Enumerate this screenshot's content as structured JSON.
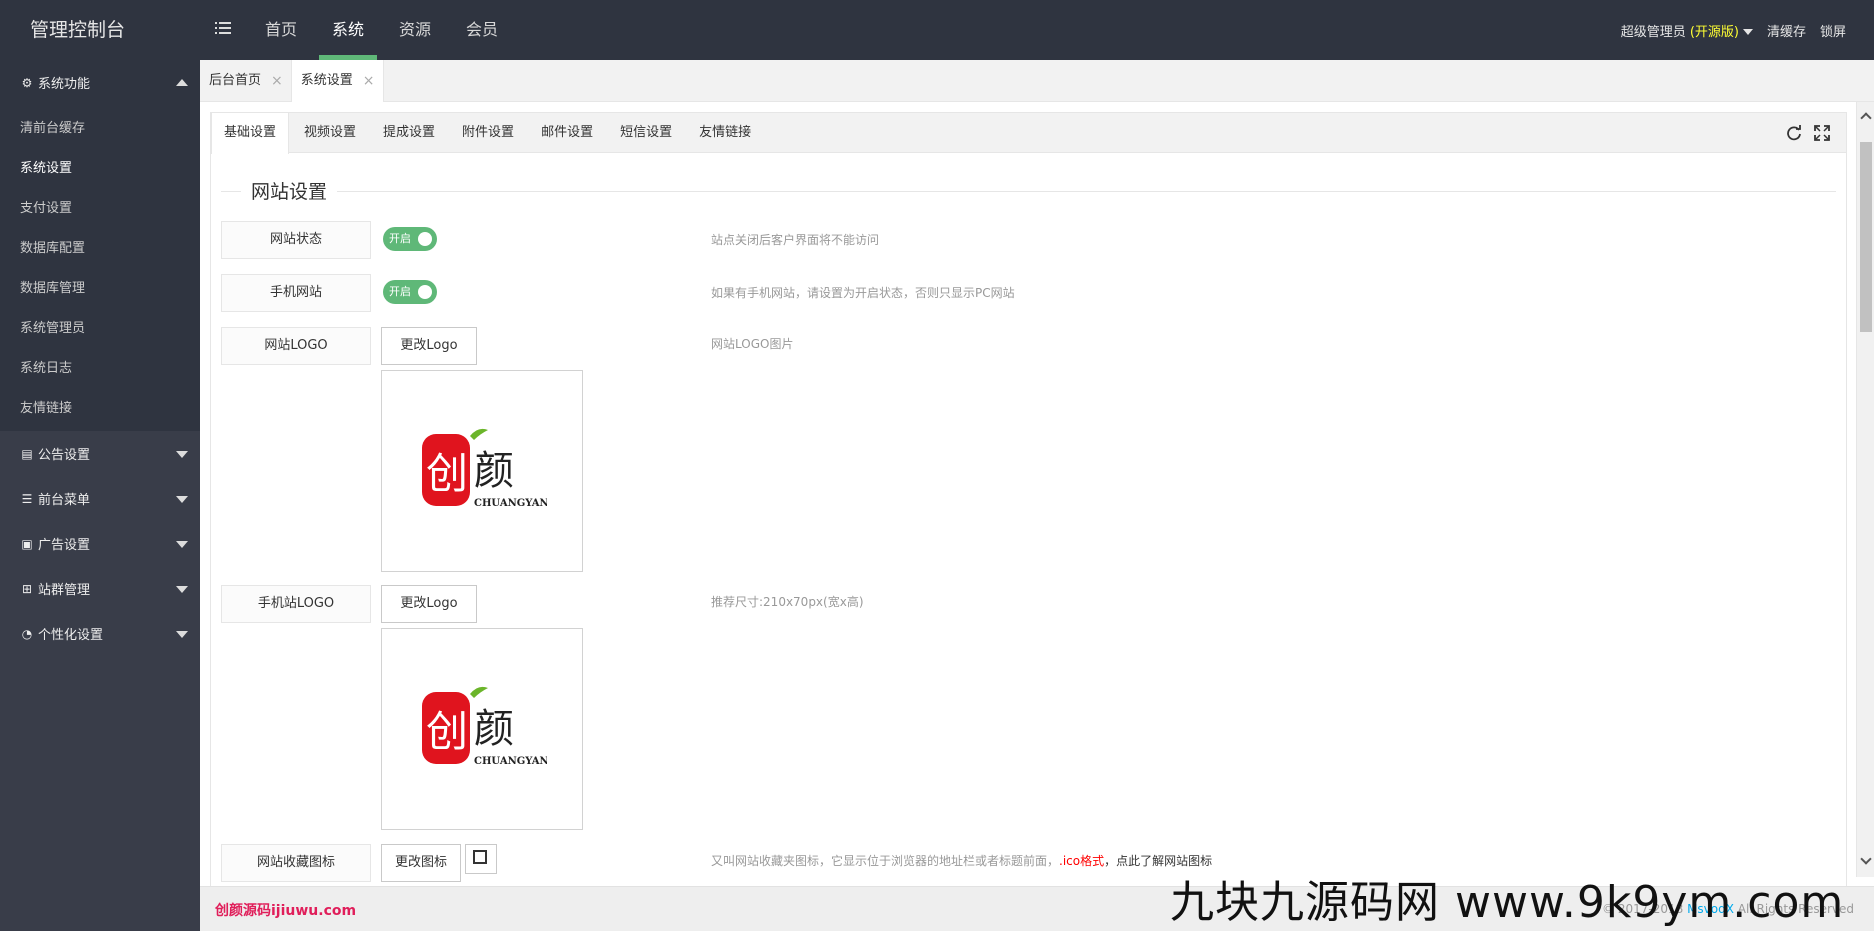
{
  "header": {
    "brand": "管理控制台",
    "nav": [
      "首页",
      "系统",
      "资源",
      "会员"
    ],
    "active_nav": "系统",
    "user": "超级管理员",
    "edition": "(开源版)",
    "clear_cache": "清缓存",
    "lock_screen": "锁屏"
  },
  "sidebar": {
    "groups": [
      {
        "label": "系统功能",
        "icon": "gear-icon",
        "expanded": true
      },
      {
        "label": "公告设置",
        "icon": "book-icon"
      },
      {
        "label": "前台菜单",
        "icon": "list-icon"
      },
      {
        "label": "广告设置",
        "icon": "image-icon"
      },
      {
        "label": "站群管理",
        "icon": "sitemap-icon"
      },
      {
        "label": "个性化设置",
        "icon": "dashboard-icon"
      }
    ],
    "items": [
      "清前台缓存",
      "系统设置",
      "支付设置",
      "数据库配置",
      "数据库管理",
      "系统管理员",
      "系统日志",
      "友情链接"
    ],
    "active_item": "系统设置"
  },
  "page_tabs": [
    {
      "label": "后台首页"
    },
    {
      "label": "系统设置"
    }
  ],
  "card_tabs": [
    "基础设置",
    "视频设置",
    "提成设置",
    "附件设置",
    "邮件设置",
    "短信设置",
    "友情链接"
  ],
  "section_title": "网站设置",
  "fields": {
    "site_status": {
      "label": "网站状态",
      "switch": "开启",
      "hint": "站点关闭后客户界面将不能访问"
    },
    "mobile_site": {
      "label": "手机网站",
      "switch": "开启",
      "hint": "如果有手机网站，请设置为开启状态，否则只显示PC网站"
    },
    "site_logo": {
      "label": "网站LOGO",
      "button": "更改Logo",
      "hint": "网站LOGO图片"
    },
    "mobile_logo": {
      "label": "手机站LOGO",
      "button": "更改Logo",
      "hint": "推荐尺寸:210x70px(宽x高)"
    },
    "favicon": {
      "label": "网站收藏图标",
      "button": "更改图标",
      "hint_a": "又叫网站收藏夹图标，它显示位于浏览器的地址栏或者标题前面，",
      "hint_b": ".ico格式",
      "hint_c": "，点此了解网站图标"
    }
  },
  "logo": {
    "glyph1": "创",
    "glyph2": "颜",
    "word": "CHUANGYAN"
  },
  "footer": {
    "left": "创颜源码ijiuwu.com",
    "copy_prefix": "© 2017-2018 ",
    "copy_link": "MsvodX",
    "copy_suffix": " All Rights Reserved"
  },
  "watermark": "九块九源码网 www.9k9ym.com",
  "colors": {
    "accent": "#5fb878",
    "sidebar": "#393d49",
    "topbar": "#2f3440"
  }
}
